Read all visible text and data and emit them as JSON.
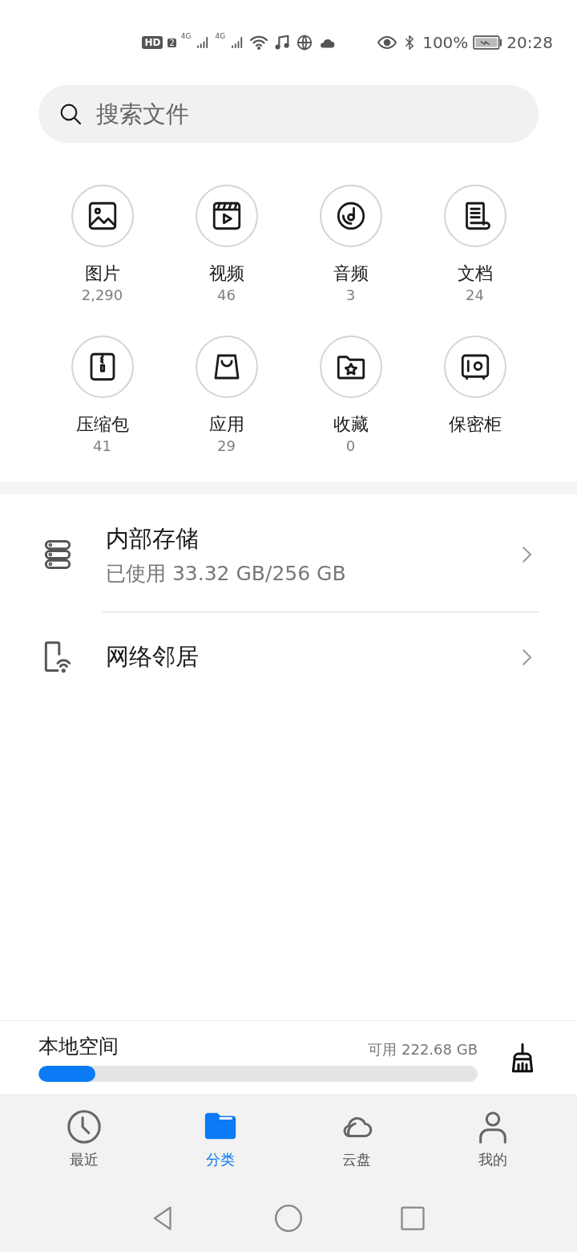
{
  "status_bar": {
    "hd_badge": "HD",
    "sim_badge": "2",
    "network_1": "4G",
    "network_2": "4G",
    "battery": "100%",
    "time": "20:28"
  },
  "search": {
    "placeholder": "搜索文件"
  },
  "categories": [
    {
      "label": "图片",
      "count": "2,290"
    },
    {
      "label": "视频",
      "count": "46"
    },
    {
      "label": "音频",
      "count": "3"
    },
    {
      "label": "文档",
      "count": "24"
    },
    {
      "label": "压缩包",
      "count": "41"
    },
    {
      "label": "应用",
      "count": "29"
    },
    {
      "label": "收藏",
      "count": "0"
    },
    {
      "label": "保密柜"
    }
  ],
  "locations": [
    {
      "title": "内部存储",
      "subtitle": "已使用 33.32 GB/256 GB"
    },
    {
      "title": "网络邻居"
    }
  ],
  "local_space": {
    "title": "本地空间",
    "available": "可用 222.68 GB",
    "level": 0.13
  },
  "tabs": [
    {
      "label": "最近",
      "selected": false
    },
    {
      "label": "分类",
      "selected": true
    },
    {
      "label": "云盘",
      "selected": false
    },
    {
      "label": "我的",
      "selected": false
    }
  ]
}
